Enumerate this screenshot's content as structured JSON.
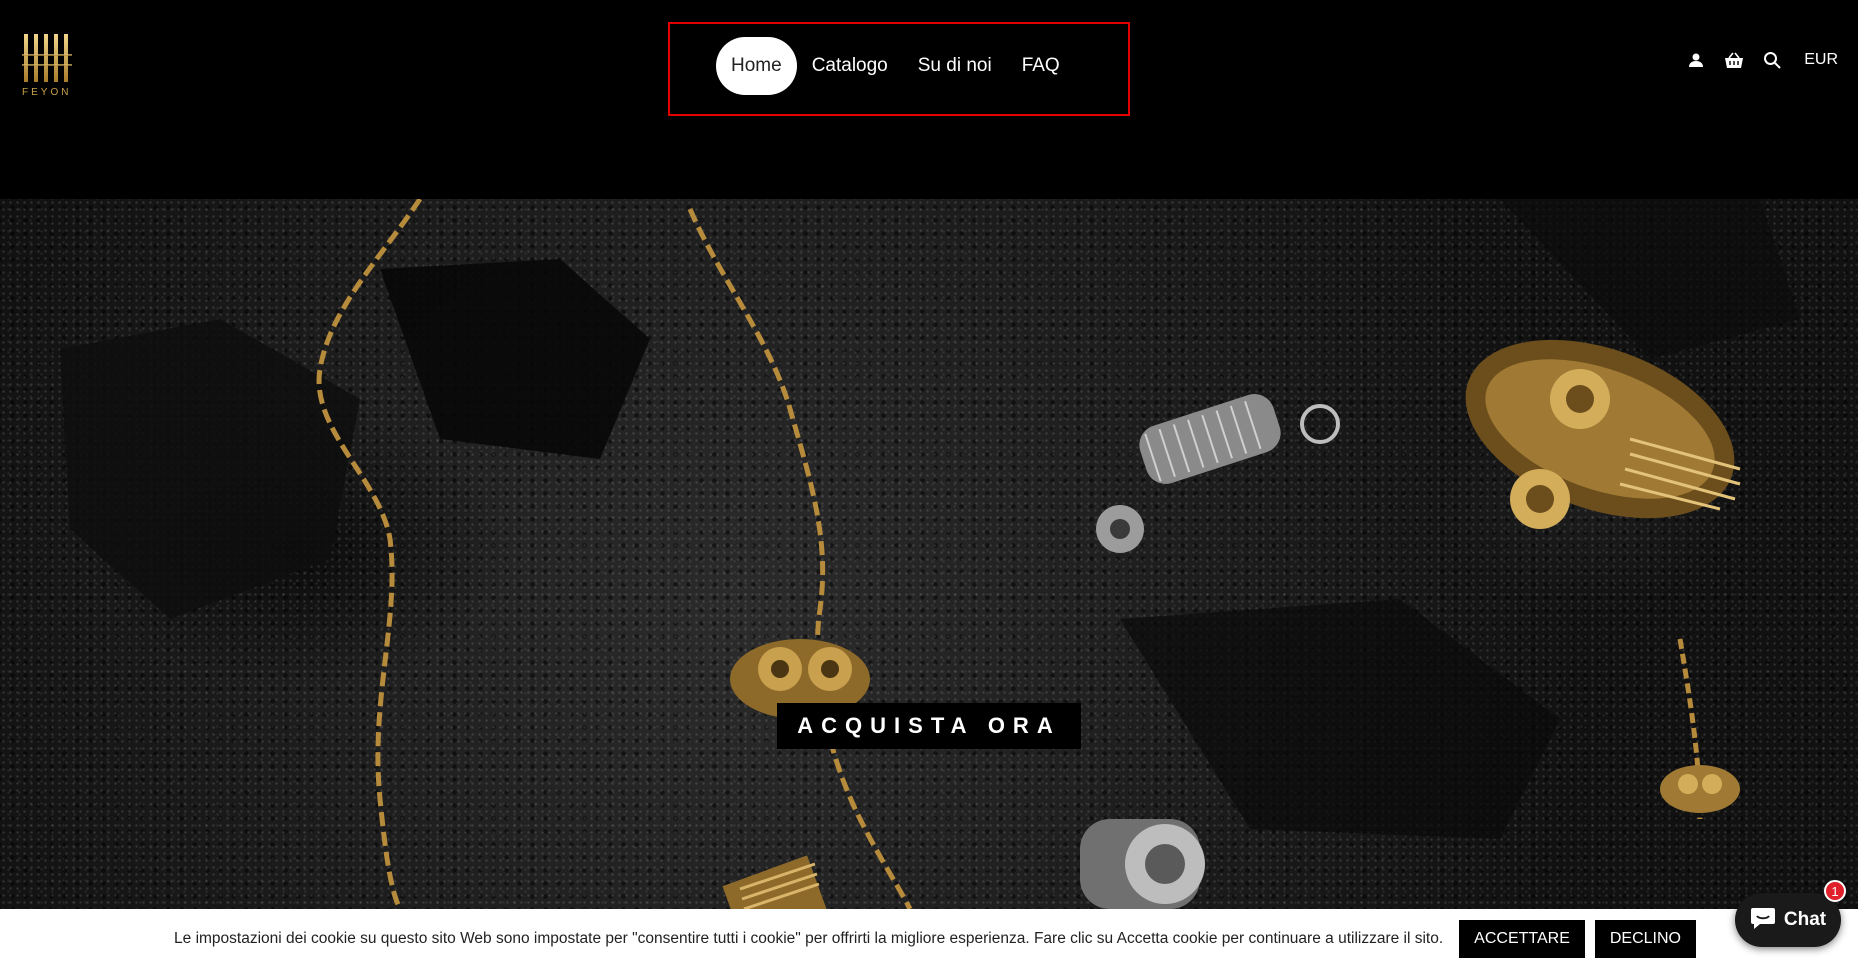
{
  "header": {
    "logo_text": "FEYON",
    "nav": [
      {
        "label": "Home",
        "active": true
      },
      {
        "label": "Catalogo",
        "active": false
      },
      {
        "label": "Su di noi",
        "active": false
      },
      {
        "label": "FAQ",
        "active": false
      }
    ],
    "icons": [
      "user-icon",
      "cart-icon",
      "search-icon"
    ],
    "currency": "EUR"
  },
  "hero": {
    "cta_label": "ACQUISTA ORA"
  },
  "cookie": {
    "text": "Le impostazioni dei cookie su questo sito Web sono impostate per \"consentire tutti i cookie\" per offrirti la migliore esperienza. Fare clic su Accetta cookie per continuare a utilizzare il sito.",
    "accept_label": "ACCETTARE",
    "decline_label": "DECLINO"
  },
  "chat": {
    "label": "Chat",
    "badge": "1"
  },
  "colors": {
    "accent_gold": "#c9a24a",
    "nav_highlight": "#e00000",
    "badge": "#e0202a"
  }
}
